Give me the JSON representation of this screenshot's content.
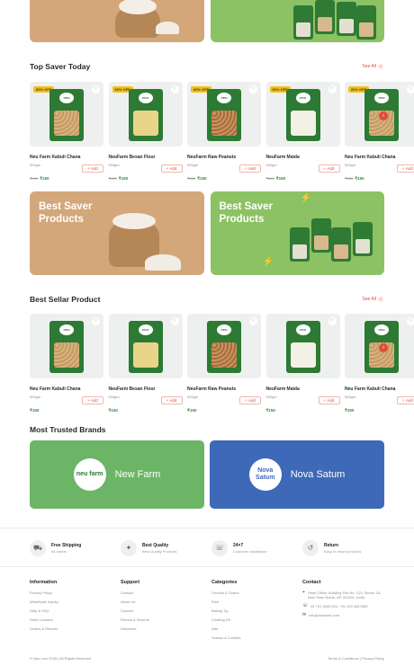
{
  "top_saver": {
    "title": "Top Saver Today",
    "see_all": "See All",
    "products": [
      {
        "badge": "60% OFF",
        "name": "Neu Farm Kabuli Chana",
        "weight": "500gm",
        "old_price": "₹400",
        "price": "₹150",
        "add": "Add",
        "variant": "chana"
      },
      {
        "badge": "60% OFF",
        "name": "NeuFarm Besan Flour",
        "weight": "500gm",
        "old_price": "₹400",
        "price": "₹150",
        "add": "Add",
        "variant": "besan"
      },
      {
        "badge": "60% OFF",
        "name": "NeuFarm Raw Peanuts",
        "weight": "500gm",
        "old_price": "₹400",
        "price": "₹150",
        "add": "Add",
        "variant": "peanut"
      },
      {
        "badge": "60% OFF",
        "name": "NeuFarm Maida",
        "weight": "500gm",
        "old_price": "₹400",
        "price": "₹150",
        "add": "Add",
        "variant": "maida"
      },
      {
        "badge": "60% OFF",
        "name": "Neu Farm Kabuli Chana",
        "weight": "500gm",
        "old_price": "₹400",
        "price": "₹150",
        "add": "Add",
        "variant": "chana"
      }
    ]
  },
  "promo": {
    "left_text": "Best Saver Products",
    "right_text": "Best Saver Products"
  },
  "best_seller": {
    "title": "Best Sellar Product",
    "see_all": "See All",
    "products": [
      {
        "name": "Neu Farm Kabuli Chana",
        "weight": "500gm",
        "price": "₹150",
        "add": "Add",
        "variant": "chana"
      },
      {
        "name": "NeuFarm Besan Flour",
        "weight": "500gm",
        "price": "₹150",
        "add": "Add",
        "variant": "besan"
      },
      {
        "name": "NeuFarm Raw Peanuts",
        "weight": "500gm",
        "price": "₹150",
        "add": "Add",
        "variant": "peanut"
      },
      {
        "name": "NeuFarm Maida",
        "weight": "500gm",
        "price": "₹150",
        "add": "Add",
        "variant": "maida"
      },
      {
        "name": "Neu Farm Kabuli Chana",
        "weight": "500gm",
        "price": "₹150",
        "add": "Add",
        "variant": "chana"
      }
    ]
  },
  "brands": {
    "title": "Most Trusted Brands",
    "items": [
      {
        "logo": "neu farm",
        "name": "New Farm"
      },
      {
        "logo": "Nova Satum",
        "name": "Nova Satum"
      }
    ]
  },
  "features": [
    {
      "title": "Free Shipping",
      "sub": "All orders",
      "icon": "truck-icon",
      "glyph": "⛟"
    },
    {
      "title": "Best Quality",
      "sub": "Best Quality Products",
      "icon": "quality-icon",
      "glyph": "✦"
    },
    {
      "title": "24×7",
      "sub": "Customer Assistance",
      "icon": "support-icon",
      "glyph": "☏"
    },
    {
      "title": "Return",
      "sub": "Easy to return products",
      "icon": "return-icon",
      "glyph": "↺"
    }
  ],
  "footer": {
    "information": {
      "title": "Information",
      "links": [
        "Privacy Policy",
        "Wholesale Inquiry",
        "Help & FAQ",
        "Store Location",
        "Orders & Returns"
      ]
    },
    "support": {
      "title": "Support",
      "links": [
        "Contact",
        "About Us",
        "Careers",
        "Refund & Returns",
        "Deliveries"
      ]
    },
    "categories": {
      "title": "Categories",
      "links": [
        "Cereals & Grains",
        "Rice",
        "Baking Sp.",
        "Cooking Oil",
        "Atta",
        "Snacks & Cookies"
      ]
    },
    "contact": {
      "title": "Contact",
      "address": "Head Office: Building Plot No. 123, Sector 1A, New Town Noida, UP 201301, India",
      "phone": "IN +91 1800 000, +91 120 4567890",
      "email": "info@neufarm.com"
    },
    "copyright": "© Neu Line 2025 | All Rights Reserved",
    "legal": "Terms & Conditions | Privacy Policy"
  }
}
